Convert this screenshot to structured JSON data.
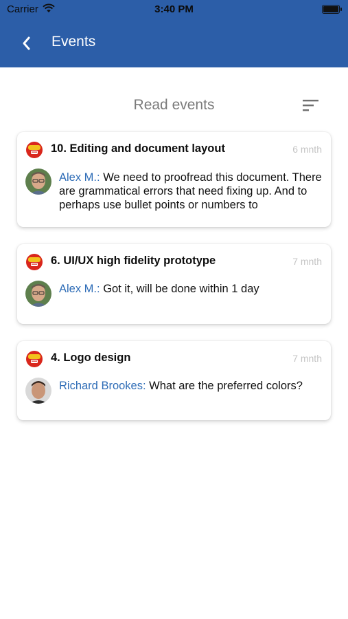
{
  "status_bar": {
    "carrier": "Carrier",
    "time": "3:40 PM"
  },
  "header": {
    "title": "Events"
  },
  "section": {
    "title": "Read events"
  },
  "events": [
    {
      "title": "10. Editing and document layout",
      "time_ago": "6 mnth",
      "author": "Alex M.:",
      "message": " We need to proofread this document. There are grammatical errors that need fixing up. And to perhaps use bullet points or numbers to"
    },
    {
      "title": "6. UI/UX high fidelity prototype",
      "time_ago": "7 mnth",
      "author": "Alex M.:",
      "message": " Got it, will be done within 1 day"
    },
    {
      "title": "4. Logo design",
      "time_ago": "7 mnth",
      "author": "Richard Brookes:",
      "message": " What are the preferred colors?"
    }
  ],
  "colors": {
    "header_bg": "#2c5ea8",
    "author_link": "#2f6db7",
    "time_ago": "#c4c4c4"
  }
}
